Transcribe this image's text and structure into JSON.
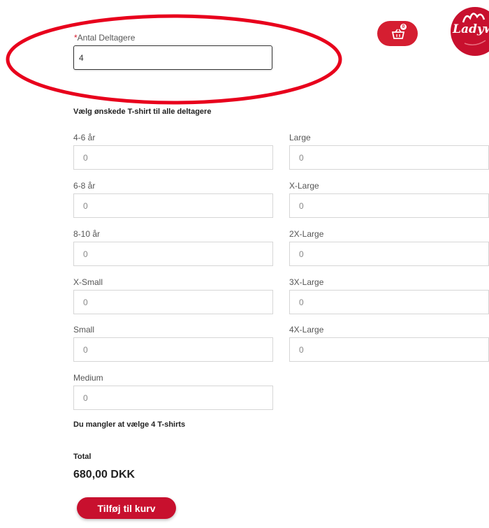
{
  "participants": {
    "required_marker": "*",
    "label": "Antal Deltagere",
    "value": "4"
  },
  "cart": {
    "count": "0",
    "icon": "basket-icon"
  },
  "logo": {
    "text": "Ladywal"
  },
  "tshirt_section": {
    "heading": "Vælg ønskede T-shirt til alle deltagere",
    "left": [
      {
        "label": "4-6 år",
        "value": "0"
      },
      {
        "label": "6-8 år",
        "value": "0"
      },
      {
        "label": "8-10 år",
        "value": "0"
      },
      {
        "label": "X-Small",
        "value": "0"
      },
      {
        "label": "Small",
        "value": "0"
      },
      {
        "label": "Medium",
        "value": "0"
      }
    ],
    "right": [
      {
        "label": "Large",
        "value": "0"
      },
      {
        "label": "X-Large",
        "value": "0"
      },
      {
        "label": "2X-Large",
        "value": "0"
      },
      {
        "label": "3X-Large",
        "value": "0"
      },
      {
        "label": "4X-Large",
        "value": "0"
      }
    ]
  },
  "missing_message": "Du mangler at vælge 4 T-shirts",
  "total": {
    "label": "Total",
    "amount": "680,00 DKK"
  },
  "add_to_cart_label": "Tilføj til kurv",
  "colors": {
    "brand_red": "#c8102e",
    "annotation_red": "#e8001c"
  }
}
